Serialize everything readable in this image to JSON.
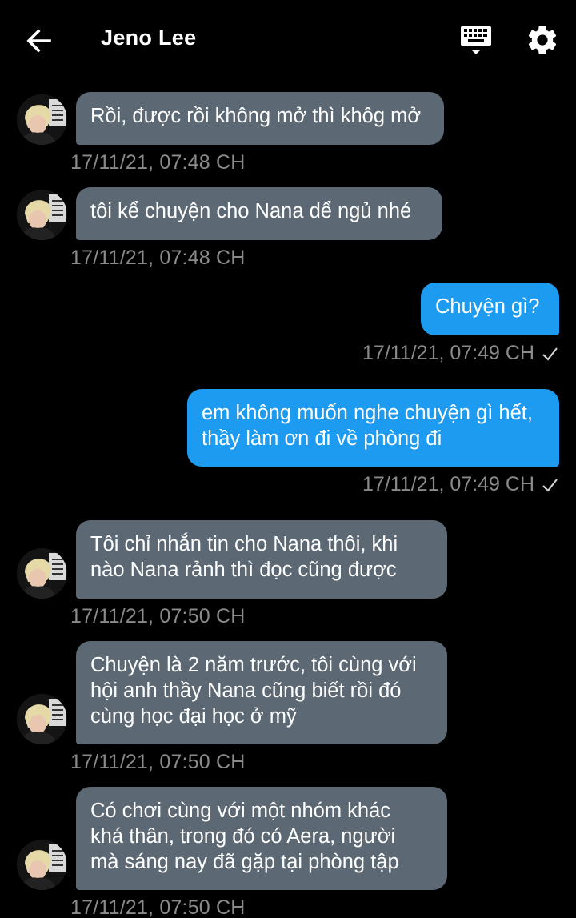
{
  "header": {
    "title": "Jeno Lee",
    "back_icon": "arrow-left-icon",
    "keyboard_icon": "keyboard-icon",
    "settings_icon": "gear-icon"
  },
  "colors": {
    "background": "#000000",
    "incoming_bubble": "#5c6873",
    "outgoing_bubble": "#1d9bf0",
    "timestamp": "#8a8a8a",
    "text": "#ffffff"
  },
  "messages": [
    {
      "direction": "in",
      "text": "Rồi, được rồi không mở thì khôg mở",
      "time": "17/11/21, 07:48 CH"
    },
    {
      "direction": "in",
      "text": "tôi kể chuyện cho Nana dể ngủ nhé",
      "time": "17/11/21, 07:48 CH"
    },
    {
      "direction": "out",
      "text": "Chuyện gì?",
      "time": "17/11/21, 07:49 CH",
      "status_icon": "check-icon"
    },
    {
      "direction": "out",
      "text": "em không muốn nghe chuyện gì hết,\nthầy làm ơn đi về phòng đi",
      "time": "17/11/21, 07:49 CH",
      "status_icon": "check-icon"
    },
    {
      "direction": "in",
      "text": "Tôi chỉ nhắn tin cho Nana thôi, khi\nnào Nana rảnh thì đọc cũng được",
      "time": "17/11/21, 07:50 CH"
    },
    {
      "direction": "in",
      "text": "Chuyện là 2 năm trước, tôi cùng với\nhội anh thầy Nana cũng biết rồi đó\ncùng học đại học ở mỹ",
      "time": "17/11/21, 07:50 CH"
    },
    {
      "direction": "in",
      "text": "Có chơi cùng với một nhóm khác\nkhá thân, trong đó có Aera, người\nmà sáng nay đã gặp tại phòng tập",
      "time": "17/11/21, 07:50 CH"
    }
  ]
}
